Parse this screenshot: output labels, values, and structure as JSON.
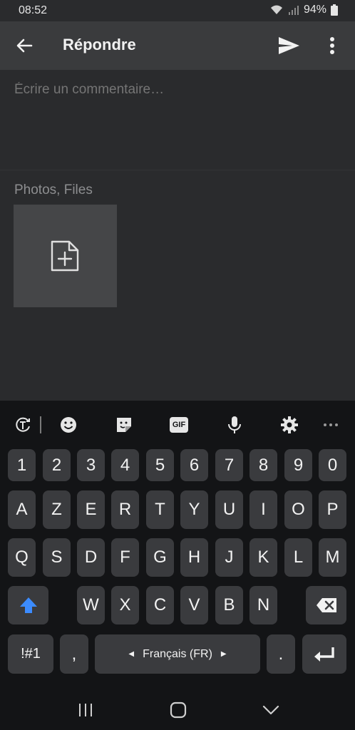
{
  "status": {
    "time": "08:52",
    "battery": "94%"
  },
  "appbar": {
    "title": "Répondre",
    "back_icon": "arrow-left-icon",
    "send_icon": "send-icon",
    "more_icon": "more-vert-icon"
  },
  "comment": {
    "placeholder": "Écrire un commentaire…",
    "value": ""
  },
  "attachments": {
    "label": "Photos, Files",
    "add_icon": "add-file-icon"
  },
  "keyboard": {
    "toolbar_icons": [
      "translate-icon",
      "emoji-icon",
      "sticker-icon",
      "gif-icon",
      "microphone-icon",
      "settings-icon",
      "more-horiz-icon"
    ],
    "gif_text": "GIF",
    "row_numbers": [
      "1",
      "2",
      "3",
      "4",
      "5",
      "6",
      "7",
      "8",
      "9",
      "0"
    ],
    "row_1": [
      "A",
      "Z",
      "E",
      "R",
      "T",
      "Y",
      "U",
      "I",
      "O",
      "P"
    ],
    "row_2": [
      "Q",
      "S",
      "D",
      "F",
      "G",
      "H",
      "J",
      "K",
      "L",
      "M"
    ],
    "row_3": [
      "W",
      "X",
      "C",
      "V",
      "B",
      "N"
    ],
    "symbols_label": "!#1",
    "comma": ",",
    "space_label": "Français (FR)",
    "period": ".",
    "shift_icon": "shift-up-icon",
    "backspace_icon": "backspace-icon",
    "enter_icon": "enter-icon",
    "accent": "#3c8cff"
  },
  "navbar": {
    "icons": [
      "recent-apps-icon",
      "home-icon",
      "back-chevron-icon"
    ]
  }
}
